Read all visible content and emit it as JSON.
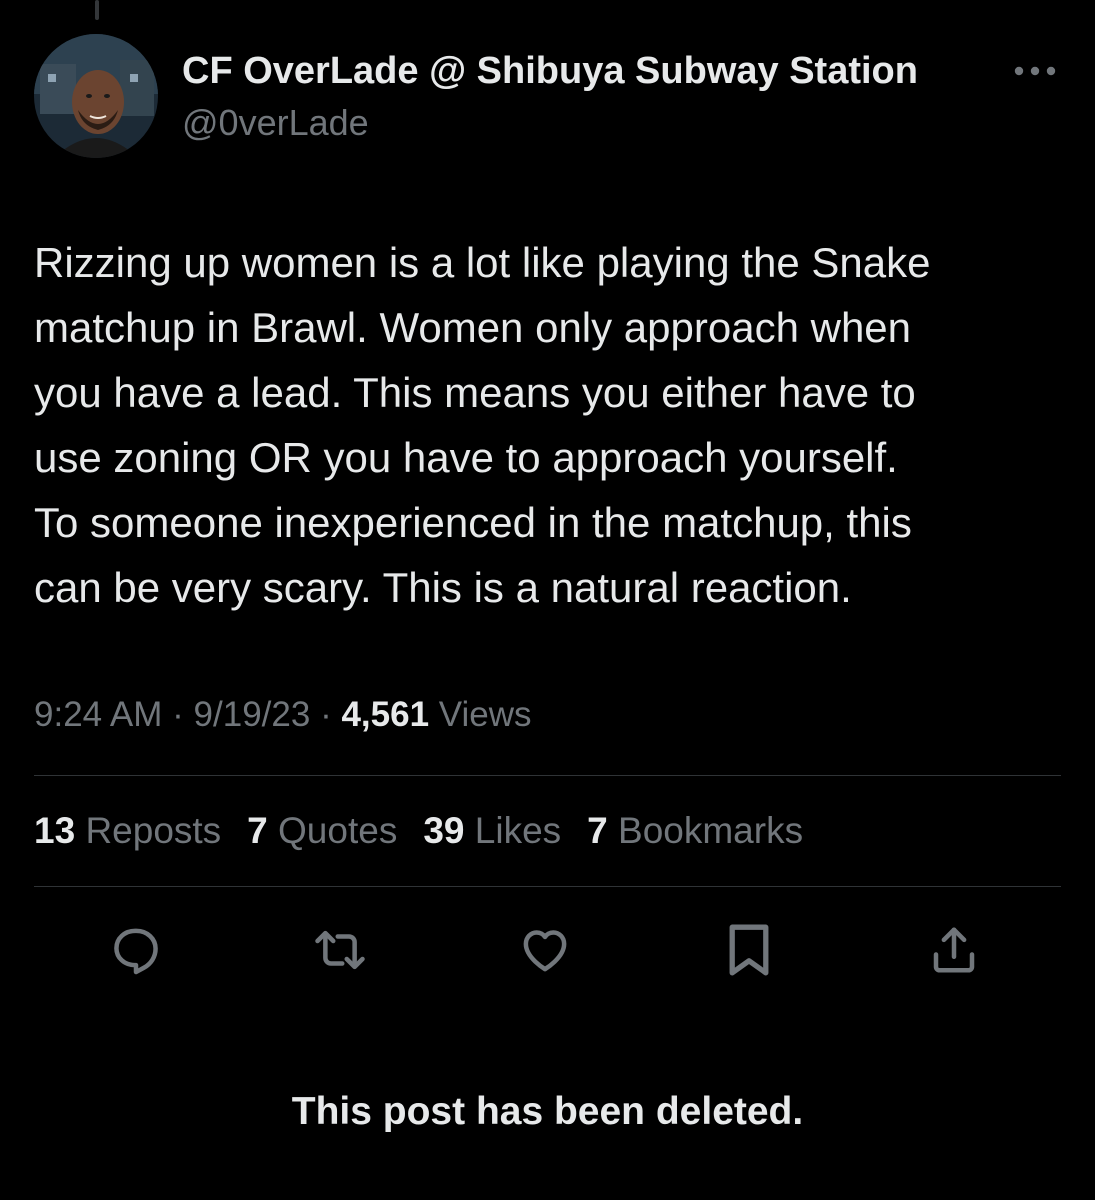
{
  "author": {
    "display_name": "CF OverLade @ Shibuya Subway Station",
    "handle": "@0verLade"
  },
  "tweet": {
    "text": "Rizzing up women is a lot like playing the Snake\nmatchup in Brawl. Women only approach when\nyou have a lead. This means you either have to\nuse zoning OR you have to approach yourself.\nTo someone inexperienced in the matchup, this\ncan be very scary. This is a natural reaction.",
    "time": "9:24 AM",
    "date": "9/19/23",
    "views_count": "4,561",
    "views_label": "Views"
  },
  "stats": {
    "reposts": {
      "count": "13",
      "label": "Reposts"
    },
    "quotes": {
      "count": "7",
      "label": "Quotes"
    },
    "likes": {
      "count": "39",
      "label": "Likes"
    },
    "bookmarks": {
      "count": "7",
      "label": "Bookmarks"
    }
  },
  "actions": [
    "reply-icon",
    "repost-icon",
    "like-icon",
    "bookmark-icon",
    "share-icon"
  ],
  "notice": "This post has been deleted.",
  "colors": {
    "background": "#000000",
    "primary_text": "#e7e9ea",
    "secondary_text": "#71767b",
    "divider": "#2f3336"
  }
}
